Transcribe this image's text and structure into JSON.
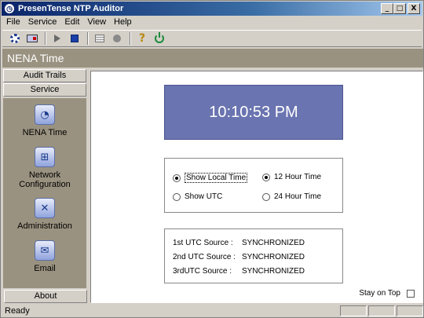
{
  "window": {
    "title": "PresenTense NTP Auditor",
    "minimize": "_",
    "maximize": "□",
    "close": "X"
  },
  "menu": [
    "File",
    "Service",
    "Edit",
    "View",
    "Help"
  ],
  "page_header": "NENA Time",
  "sidebar": {
    "audit_trails": "Audit Trails",
    "service": "Service",
    "items": [
      {
        "label": "NENA Time",
        "icon": "clock-icon"
      },
      {
        "label": "Network\nConfiguration",
        "icon": "network-icon"
      },
      {
        "label": "Administration",
        "icon": "tools-icon"
      },
      {
        "label": "Email",
        "icon": "email-icon"
      }
    ],
    "about": "About"
  },
  "clock": {
    "time": "10:10:53 PM"
  },
  "options": {
    "show_local": "Show Local Time",
    "show_utc": "Show UTC",
    "hour12": "12 Hour Time",
    "hour24": "24 Hour Time",
    "selected_zone": "local",
    "selected_format": "12"
  },
  "sources": [
    {
      "label": "1st UTC Source :",
      "status": "SYNCHRONIZED"
    },
    {
      "label": "2nd UTC Source :",
      "status": "SYNCHRONIZED"
    },
    {
      "label": "3rdUTC Source :",
      "status": "SYNCHRONIZED"
    }
  ],
  "stay_on_top": {
    "label": "Stay on Top",
    "checked": false
  },
  "status": "Ready"
}
